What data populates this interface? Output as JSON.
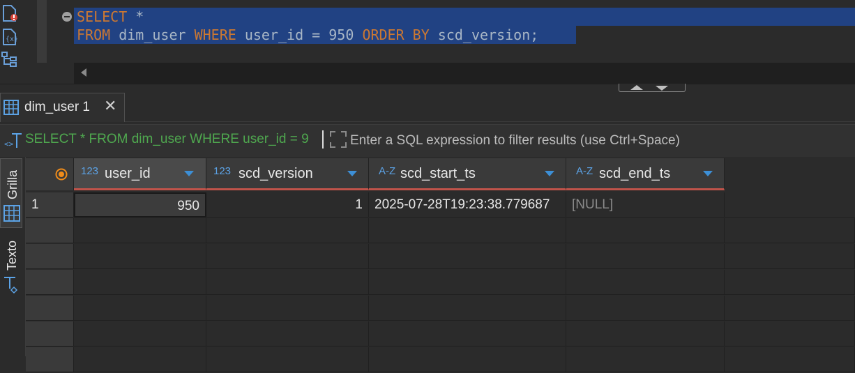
{
  "editor": {
    "line1_kw_select": "SELECT",
    "line1_rest": " *",
    "line2_kw_from": "FROM",
    "line2_table": " dim_user ",
    "line2_kw_where": "WHERE",
    "line2_cond": " user_id = 950 ",
    "line2_kw_orderby": "ORDER BY",
    "line2_tail": " scd_version;"
  },
  "result_tab": {
    "label": "dim_user 1",
    "close": "✕"
  },
  "filter": {
    "query": "SELECT * FROM dim_user WHERE user_id = 9",
    "placeholder": "Enter a SQL expression to filter results (use Ctrl+Space)"
  },
  "side_tabs": {
    "grid": "Grilla",
    "text": "Texto"
  },
  "columns": [
    {
      "type": "123",
      "name": "user_id"
    },
    {
      "type": "123",
      "name": "scd_version"
    },
    {
      "type": "A-Z",
      "name": "scd_start_ts"
    },
    {
      "type": "A-Z",
      "name": "scd_end_ts"
    }
  ],
  "rows": [
    {
      "num": "1",
      "user_id": "950",
      "scd_version": "1",
      "scd_start_ts": "2025-07-28T19:23:38.779687",
      "scd_end_ts": "[NULL]"
    }
  ],
  "colors": {
    "accent": "#3d8fd6",
    "header_underline": "#c0534a",
    "selection": "#214283"
  }
}
